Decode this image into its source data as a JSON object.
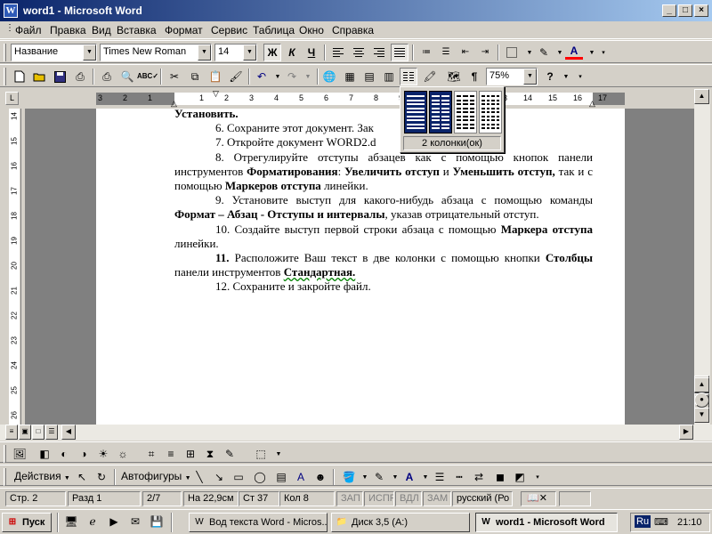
{
  "window": {
    "title": "word1 - Microsoft Word",
    "icon": "W",
    "controls": [
      "_",
      "□",
      "×"
    ]
  },
  "menu": [
    "Файл",
    "Правка",
    "Вид",
    "Вставка",
    "Формат",
    "Сервис",
    "Таблица",
    "Окно",
    "Справка"
  ],
  "formatting": {
    "style": "Название",
    "font": "Times New Roman",
    "size": "14",
    "bold": "Ж",
    "italic": "К",
    "underline": "Ч",
    "font_color_glyph": "A"
  },
  "standard": {
    "zoom": "75%",
    "help_glyph": "?",
    "pilcrow": "¶"
  },
  "columns_popup": {
    "caption": "2 колонки(ок)",
    "selected": 2
  },
  "ruler": {
    "h_ticks": [
      "3",
      "2",
      "1",
      "1",
      "2",
      "3",
      "4",
      "5",
      "6",
      "7",
      "8",
      "9",
      "10",
      "11",
      "12",
      "13",
      "14",
      "15",
      "16",
      "17"
    ],
    "v_ticks": [
      "14",
      "15",
      "16",
      "17",
      "18",
      "19",
      "20",
      "21",
      "22",
      "23",
      "24",
      "25",
      "26"
    ]
  },
  "document": {
    "first_line": "Установить.",
    "items": [
      {
        "num": "6.",
        "text": "Сохраните этот документ. Зак"
      },
      {
        "num": "7.",
        "text": "Откройте документ WORD2.d"
      },
      {
        "num": "8.",
        "parts": [
          "Отрегулируйте отступы абзацев как с помощью кнопок панели инструментов ",
          "Форматирования",
          ": ",
          "Увеличить отступ",
          " и ",
          "Уменьшить отступ,",
          " так и с помощью ",
          "Маркеров отступа",
          " линейки."
        ]
      },
      {
        "num": "9.",
        "parts": [
          "Установите выступ для какого-нибудь абзаца с помощью команды ",
          "Формат – Абзац - Отступы и интервалы",
          ", указав отрицательный отступ."
        ]
      },
      {
        "num": "10.",
        "parts": [
          "Создайте выступ первой строки абзаца с помощью ",
          "Маркера отступа",
          " линейки."
        ]
      },
      {
        "num": "11.",
        "parts": [
          "Расположите Ваш текст в две колонки с помощью кнопки ",
          "Столбцы",
          " панели инструментов ",
          "Стандартная."
        ]
      },
      {
        "num": "12.",
        "text": "Сохраните и закройте файл."
      }
    ]
  },
  "drawing": {
    "actions": "Действия",
    "autoshapes": "Автофигуры"
  },
  "status": {
    "page": "Стр.  2",
    "section": "Разд  1",
    "pages": "2/7",
    "at": "На 22,9см",
    "line": "Ст  37",
    "col": "Кол  8",
    "rec": "ЗАП",
    "trk": "ИСПР",
    "ext": "ВДЛ",
    "ovr": "ЗАМ",
    "lang": "русский (Ро"
  },
  "taskbar": {
    "start": "Пуск",
    "tasks": [
      "Вод текста Word - Micros...",
      "Диск 3,5 (A:)",
      "word1 - Microsoft Word"
    ],
    "lang": "Ru",
    "time": "21:10"
  },
  "colors": {
    "title_start": "#0a246a",
    "title_end": "#a6caf0",
    "chrome": "#d4d0c8",
    "doc_bg": "#808080",
    "selected": "#0a246a"
  }
}
